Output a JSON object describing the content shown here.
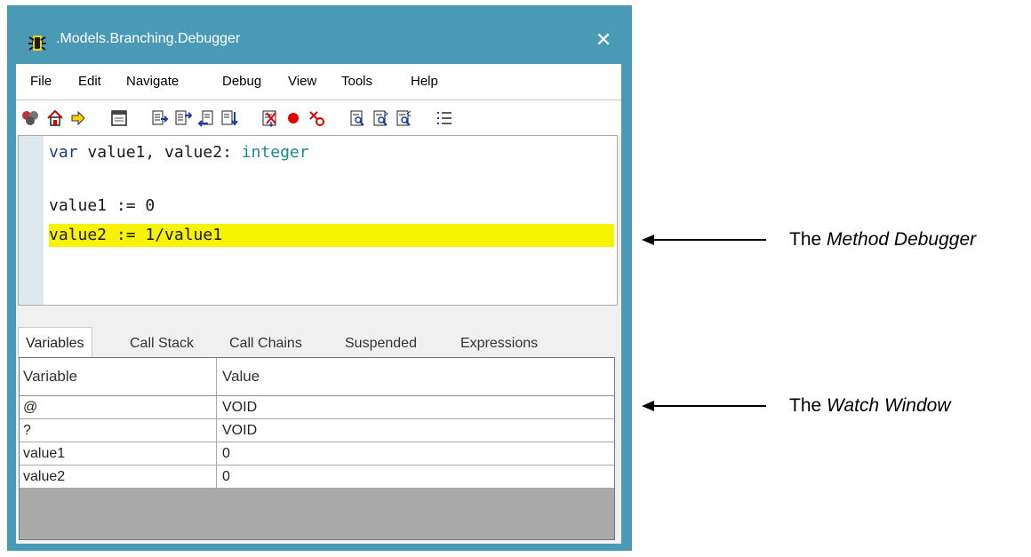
{
  "window": {
    "title": ".Models.Branching.Debugger",
    "close_glyph": "✕",
    "frame_color": "#4a9ab5"
  },
  "menu": [
    "File",
    "Edit",
    "Navigate",
    "Debug",
    "View",
    "Tools",
    "Help"
  ],
  "toolbar_icons": [
    "breakpoints-icon",
    "home-icon",
    "arrow-right-icon",
    "window-icon",
    "step-into-icon",
    "step-over-icon",
    "step-out-icon",
    "run-to-cursor-icon",
    "clear-breakpoints-icon",
    "breakpoint-icon",
    "delete-breakpoint-icon",
    "find-icon",
    "find-next-icon",
    "find-previous-icon",
    "list-icon"
  ],
  "editor": {
    "lines": [
      {
        "kw": "var",
        "rest": " value1, value2: ",
        "type": "integer"
      },
      {
        "text": ""
      },
      {
        "text": "value1 := 0"
      },
      {
        "text": "value2 := 1/value1",
        "highlighted": true
      }
    ],
    "highlight_color": "#f7f200"
  },
  "tabs": [
    "Variables",
    "Call Stack",
    "Call Chains",
    "Suspended",
    "Expressions"
  ],
  "active_tab": "Variables",
  "watch": {
    "columns": [
      "Variable",
      "Value"
    ],
    "rows": [
      [
        "@",
        "VOID"
      ],
      [
        "?",
        "VOID"
      ],
      [
        "value1",
        "0"
      ],
      [
        "value2",
        "0"
      ]
    ]
  },
  "annotations": {
    "method": {
      "prefix": "The ",
      "emph": "Method Debugger"
    },
    "watch": {
      "prefix": "The ",
      "emph": "Watch Window"
    }
  }
}
